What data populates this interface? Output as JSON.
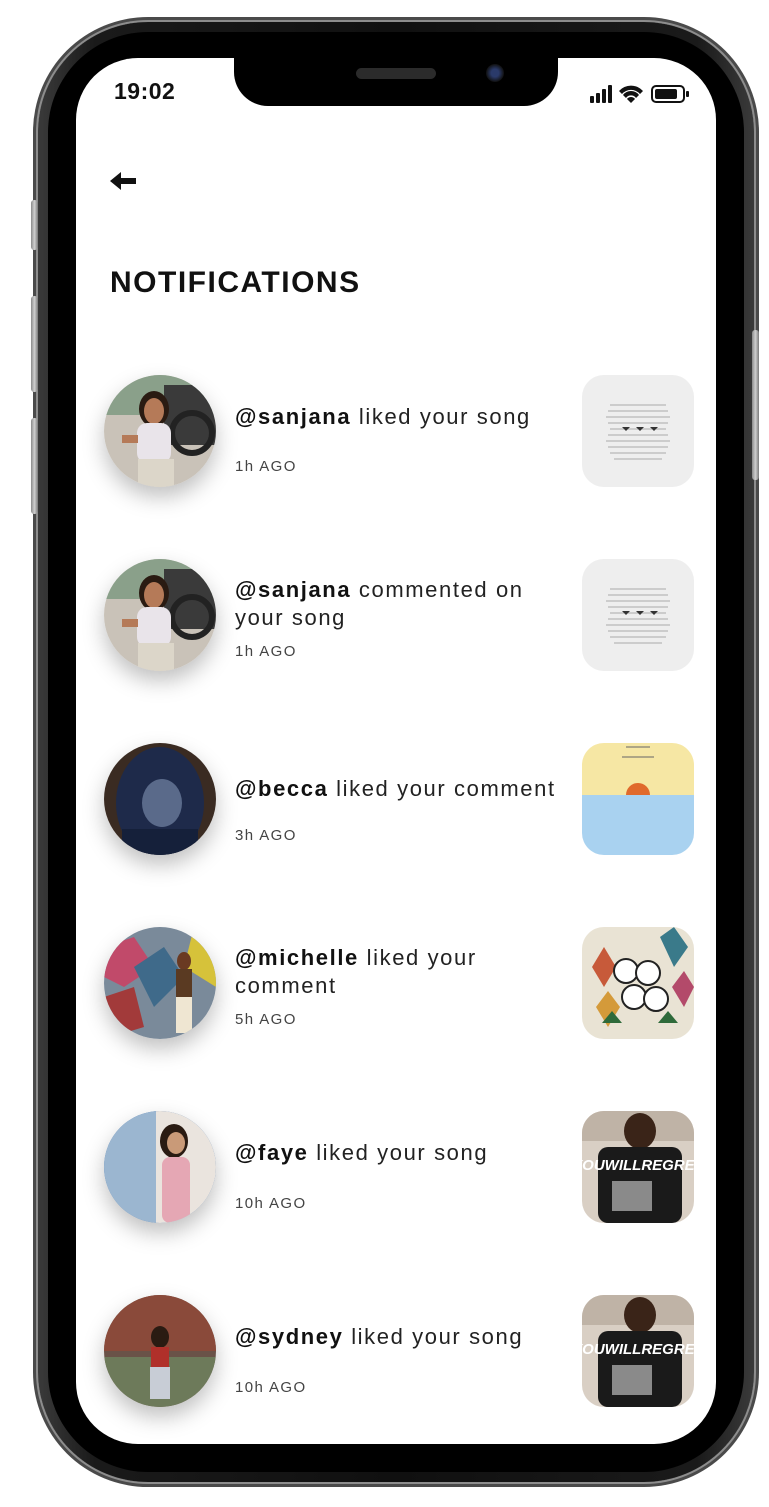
{
  "status_bar": {
    "time": "19:02",
    "icons": [
      "signal-icon",
      "wifi-icon",
      "battery-icon"
    ]
  },
  "header": {
    "back_icon": "back-arrow-icon",
    "title": "NOTIFICATIONS"
  },
  "notifications": [
    {
      "user": "@sanjana",
      "action": " liked your song",
      "time": "1h AGO",
      "thumb": "text-sheet"
    },
    {
      "user": "@sanjana",
      "action": " commented on your song",
      "time": "1h AGO",
      "thumb": "text-sheet"
    },
    {
      "user": "@becca",
      "action": " liked your comment",
      "time": "3h AGO",
      "thumb": "sunset"
    },
    {
      "user": "@michelle",
      "action": " liked your comment",
      "time": "5h AGO",
      "thumb": "illustration"
    },
    {
      "user": "@faye",
      "action": " liked your song",
      "time": "10h AGO",
      "thumb": "youwillregret",
      "thumb_text": "YOUWILLREGRET"
    },
    {
      "user": "@sydney",
      "action": " liked your song",
      "time": "10h AGO",
      "thumb": "youwillregret",
      "thumb_text": "YOUWILLREGRET"
    }
  ],
  "colors": {
    "text": "#111111",
    "secondary": "#444444",
    "background": "#ffffff",
    "sun": "#e06a2c",
    "sky": "#f6e7a4",
    "water": "#a9d2f0"
  }
}
